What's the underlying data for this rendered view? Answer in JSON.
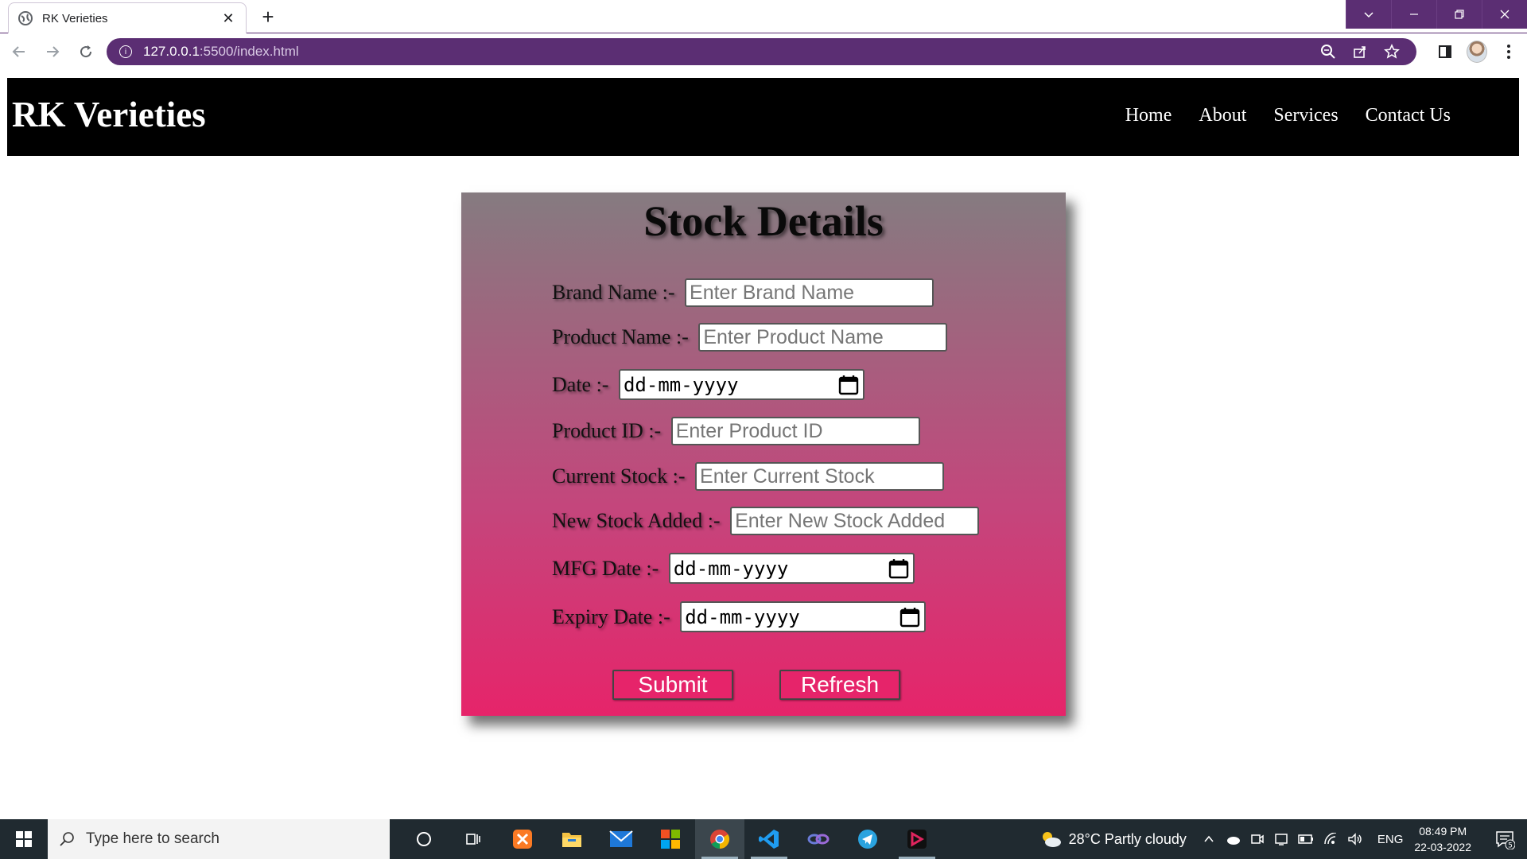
{
  "browser": {
    "tab_title": "RK Verieties",
    "tab_close": "✕",
    "new_tab": "+",
    "url_host": "127.0.0.1",
    "url_rest": ":5500/index.html"
  },
  "site": {
    "brand": "RK Verieties",
    "nav": [
      "Home",
      "About",
      "Services",
      "Contact Us"
    ]
  },
  "form": {
    "title": "Stock Details",
    "fields": [
      {
        "label": "Brand Name :- ",
        "placeholder": "Enter Brand Name",
        "type": "text"
      },
      {
        "label": "Product Name :- ",
        "placeholder": "Enter Product Name",
        "type": "text"
      },
      {
        "label": "Date :- ",
        "placeholder": "dd-mm-yyyy",
        "type": "date"
      },
      {
        "label": "Product ID :- ",
        "placeholder": "Enter Product ID",
        "type": "text"
      },
      {
        "label": "Current Stock :- ",
        "placeholder": "Enter Current Stock",
        "type": "text"
      },
      {
        "label": "New Stock Added :- ",
        "placeholder": "Enter New Stock Added",
        "type": "text"
      },
      {
        "label": "MFG Date :- ",
        "placeholder": "dd-mm-yyyy",
        "type": "date"
      },
      {
        "label": "Expiry Date :- ",
        "placeholder": "dd-mm-yyyy",
        "type": "date"
      }
    ],
    "submit_label": "Submit",
    "refresh_label": "Refresh"
  },
  "taskbar": {
    "search_placeholder": "Type here to search",
    "weather": "28°C  Partly cloudy",
    "language": "ENG",
    "time": "08:49 PM",
    "date": "22-03-2022",
    "notification_count": "5"
  },
  "colors": {
    "chrome_accent": "#5b2e73",
    "header_bg": "#000000",
    "card_top": "#857b80",
    "card_bottom": "#e6246a",
    "button_bg": "#e6246a"
  }
}
